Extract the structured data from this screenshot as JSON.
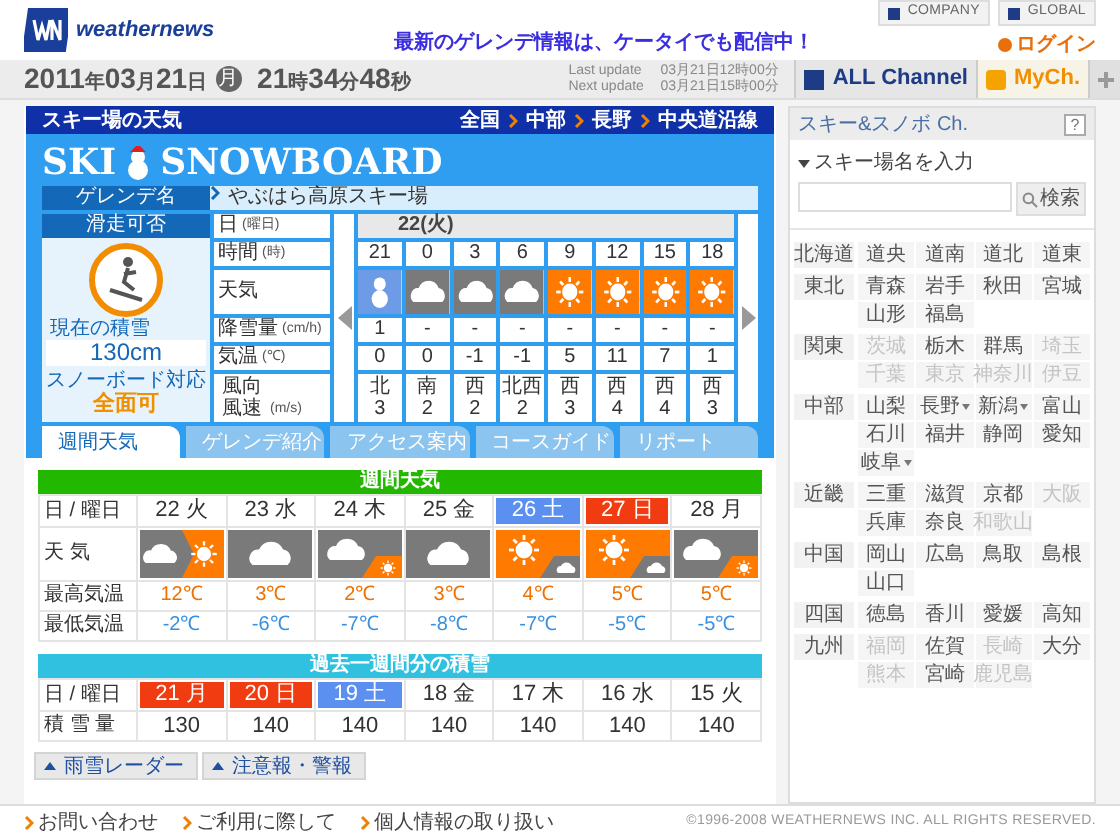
{
  "header": {
    "logo": "weathernews",
    "banner": "最新のゲレンデ情報は、ケータイでも配信中！",
    "links": [
      "COMPANY",
      "GLOBAL"
    ],
    "login": "ログイン"
  },
  "clock": {
    "date": [
      {
        "value": "2011",
        "unit": "年"
      },
      {
        "value": "03",
        "unit": "月"
      },
      {
        "value": "21",
        "unit": "日"
      }
    ],
    "weekday": "月",
    "time": [
      {
        "value": "21",
        "unit": "時"
      },
      {
        "value": "34",
        "unit": "分"
      },
      {
        "value": "48",
        "unit": "秒"
      }
    ]
  },
  "updates": [
    {
      "label": "Last update",
      "value": "03月21日12時00分"
    },
    {
      "label": "Next update",
      "value": "03月21日15時00分"
    }
  ],
  "channels": [
    {
      "label": "ALL Channel",
      "selected": false
    },
    {
      "label": "MyCh.",
      "selected": true
    }
  ],
  "ski": {
    "title": "スキー場の天気",
    "breadcrumb": [
      "全国",
      "中部",
      "長野",
      "中央道沿線"
    ],
    "banner": [
      "SKI",
      "SNOWBOARD"
    ],
    "resort_label": "ゲレンデ名",
    "resort": "やぶはら高原スキー場",
    "status": {
      "title": "滑走可否",
      "depth_label": "現在の積雪",
      "depth": "130cm",
      "snowboard_label": "スノーボード対応",
      "snowboard": "全面可"
    },
    "hourly": {
      "labels": [
        {
          "label": "日",
          "unit": "(曜日)"
        },
        {
          "label": "時間",
          "unit": "(時)"
        },
        {
          "label": "天気"
        },
        {
          "label": "降雪量",
          "unit": "(cm/h)"
        },
        {
          "label": "気温",
          "unit": "(℃)"
        },
        {
          "label": "風向",
          "label2": "風速",
          "unit": "(m/s)"
        }
      ],
      "day": "22(火)",
      "hours": [
        {
          "time": "21",
          "weather": {
            "kind": "snow"
          },
          "snow": "1",
          "temp": "0",
          "wind_dir": "北",
          "wind_speed": "3"
        },
        {
          "time": "0",
          "weather": {
            "kind": "cloud"
          },
          "snow": "-",
          "temp": "0",
          "wind_dir": "南",
          "wind_speed": "2"
        },
        {
          "time": "3",
          "weather": {
            "kind": "cloud"
          },
          "snow": "-",
          "temp": "-1",
          "wind_dir": "西",
          "wind_speed": "2"
        },
        {
          "time": "6",
          "weather": {
            "kind": "cloud"
          },
          "snow": "-",
          "temp": "-1",
          "wind_dir": "北西",
          "wind_speed": "2"
        },
        {
          "time": "9",
          "weather": {
            "kind": "sun"
          },
          "snow": "-",
          "temp": "5",
          "wind_dir": "西",
          "wind_speed": "3"
        },
        {
          "time": "12",
          "weather": {
            "kind": "sun"
          },
          "snow": "-",
          "temp": "11",
          "wind_dir": "西",
          "wind_speed": "4"
        },
        {
          "time": "15",
          "weather": {
            "kind": "sun"
          },
          "snow": "-",
          "temp": "7",
          "wind_dir": "西",
          "wind_speed": "4"
        },
        {
          "time": "18",
          "weather": {
            "kind": "sun"
          },
          "snow": "-",
          "temp": "1",
          "wind_dir": "西",
          "wind_speed": "3"
        }
      ]
    },
    "tabs": [
      {
        "label": "週間天気",
        "selected": true
      },
      {
        "label": "ゲレンデ紹介",
        "selected": false
      },
      {
        "label": "アクセス案内",
        "selected": false
      },
      {
        "label": "コースガイド",
        "selected": false
      },
      {
        "label": "リポート",
        "selected": false
      }
    ],
    "weekly": {
      "title": "週間天気",
      "labels": [
        "日 / 曜日",
        "天 気",
        "最高気温",
        "最低気温"
      ],
      "days": [
        {
          "day": "22 火",
          "weather": {
            "kind": "cloud_then_sun"
          },
          "high": "12℃",
          "low": "-2℃"
        },
        {
          "day": "23 水",
          "weather": {
            "kind": "cloud"
          },
          "high": "3℃",
          "low": "-6℃"
        },
        {
          "day": "24 木",
          "weather": {
            "kind": "cloud_sometimes_sun"
          },
          "high": "2℃",
          "low": "-7℃"
        },
        {
          "day": "25 金",
          "weather": {
            "kind": "cloud"
          },
          "high": "3℃",
          "low": "-8℃"
        },
        {
          "day": "26 土",
          "color": "#5b8ff0",
          "weather": {
            "kind": "sun_sometimes_cloud"
          },
          "high": "4℃",
          "low": "-7℃"
        },
        {
          "day": "27 日",
          "color": "#f03c10",
          "weather": {
            "kind": "sun_sometimes_cloud"
          },
          "high": "5℃",
          "low": "-5℃"
        },
        {
          "day": "28 月",
          "weather": {
            "kind": "cloud_sometimes_sun"
          },
          "high": "5℃",
          "low": "-5℃"
        }
      ]
    },
    "past": {
      "title": "過去一週間分の積雪",
      "labels": [
        "日 / 曜日",
        "積 雪 量"
      ],
      "days": [
        {
          "day": "21 月",
          "color": "#f03c10",
          "depth": "130"
        },
        {
          "day": "20 日",
          "color": "#f03c10",
          "depth": "140"
        },
        {
          "day": "19 土",
          "color": "#5b8ff0",
          "depth": "140"
        },
        {
          "day": "18 金",
          "depth": "140"
        },
        {
          "day": "17 木",
          "depth": "140"
        },
        {
          "day": "16 水",
          "depth": "140"
        },
        {
          "day": "15 火",
          "depth": "140"
        }
      ]
    },
    "bottom_buttons": [
      "雨雪レーダー",
      "注意報・警報"
    ]
  },
  "sidebar": {
    "title": "スキー&スノボ Ch.",
    "help": "?",
    "search_label": "スキー場名を入力",
    "search_button": "検索",
    "regions": [
      {
        "name": "北海道",
        "prefs": [
          {
            "name": "道央",
            "disabled": false,
            "menu": false
          },
          {
            "name": "道南",
            "disabled": false,
            "menu": false
          },
          {
            "name": "道北",
            "disabled": false,
            "menu": false
          },
          {
            "name": "道東",
            "disabled": false,
            "menu": false
          }
        ]
      },
      {
        "name": "東北",
        "prefs": [
          {
            "name": "青森",
            "disabled": false,
            "menu": false
          },
          {
            "name": "岩手",
            "disabled": false,
            "menu": false
          },
          {
            "name": "秋田",
            "disabled": false,
            "menu": false
          },
          {
            "name": "宮城",
            "disabled": false,
            "menu": false
          },
          {
            "name": "山形",
            "disabled": false,
            "menu": false
          },
          {
            "name": "福島",
            "disabled": false,
            "menu": false
          }
        ]
      },
      {
        "name": "関東",
        "prefs": [
          {
            "name": "茨城",
            "disabled": true,
            "menu": false
          },
          {
            "name": "栃木",
            "disabled": false,
            "menu": false
          },
          {
            "name": "群馬",
            "disabled": false,
            "menu": false
          },
          {
            "name": "埼玉",
            "disabled": true,
            "menu": false
          },
          {
            "name": "千葉",
            "disabled": true,
            "menu": false
          },
          {
            "name": "東京",
            "disabled": true,
            "menu": false
          },
          {
            "name": "神奈川",
            "disabled": true,
            "menu": false
          },
          {
            "name": "伊豆",
            "disabled": true,
            "menu": false
          }
        ]
      },
      {
        "name": "中部",
        "prefs": [
          {
            "name": "山梨",
            "disabled": false,
            "menu": false
          },
          {
            "name": "長野",
            "disabled": false,
            "menu": true
          },
          {
            "name": "新潟",
            "disabled": false,
            "menu": true
          },
          {
            "name": "富山",
            "disabled": false,
            "menu": false
          },
          {
            "name": "石川",
            "disabled": false,
            "menu": false
          },
          {
            "name": "福井",
            "disabled": false,
            "menu": false
          },
          {
            "name": "静岡",
            "disabled": false,
            "menu": false
          },
          {
            "name": "愛知",
            "disabled": false,
            "menu": false
          },
          {
            "name": "岐阜",
            "disabled": false,
            "menu": true
          }
        ]
      },
      {
        "name": "近畿",
        "prefs": [
          {
            "name": "三重",
            "disabled": false,
            "menu": false
          },
          {
            "name": "滋賀",
            "disabled": false,
            "menu": false
          },
          {
            "name": "京都",
            "disabled": false,
            "menu": false
          },
          {
            "name": "大阪",
            "disabled": true,
            "menu": false
          },
          {
            "name": "兵庫",
            "disabled": false,
            "menu": false
          },
          {
            "name": "奈良",
            "disabled": false,
            "menu": false
          },
          {
            "name": "和歌山",
            "disabled": true,
            "menu": false
          }
        ]
      },
      {
        "name": "中国",
        "prefs": [
          {
            "name": "岡山",
            "disabled": false,
            "menu": false
          },
          {
            "name": "広島",
            "disabled": false,
            "menu": false
          },
          {
            "name": "鳥取",
            "disabled": false,
            "menu": false
          },
          {
            "name": "島根",
            "disabled": false,
            "menu": false
          },
          {
            "name": "山口",
            "disabled": false,
            "menu": false
          }
        ]
      },
      {
        "name": "四国",
        "prefs": [
          {
            "name": "徳島",
            "disabled": false,
            "menu": false
          },
          {
            "name": "香川",
            "disabled": false,
            "menu": false
          },
          {
            "name": "愛媛",
            "disabled": false,
            "menu": false
          },
          {
            "name": "高知",
            "disabled": false,
            "menu": false
          }
        ]
      },
      {
        "name": "九州",
        "prefs": [
          {
            "name": "福岡",
            "disabled": true,
            "menu": false
          },
          {
            "name": "佐賀",
            "disabled": false,
            "menu": false
          },
          {
            "name": "長崎",
            "disabled": true,
            "menu": false
          },
          {
            "name": "大分",
            "disabled": false,
            "menu": false
          },
          {
            "name": "熊本",
            "disabled": true,
            "menu": false
          },
          {
            "name": "宮崎",
            "disabled": false,
            "menu": false
          },
          {
            "name": "鹿児島",
            "disabled": true,
            "menu": false
          }
        ]
      }
    ]
  },
  "footer": {
    "links": [
      "お問い合わせ",
      "ご利用に際して",
      "個人情報の取り扱い"
    ],
    "copyright": "©1996-2008 WEATHERNEWS INC. ALL RIGHTS RESERVED."
  }
}
